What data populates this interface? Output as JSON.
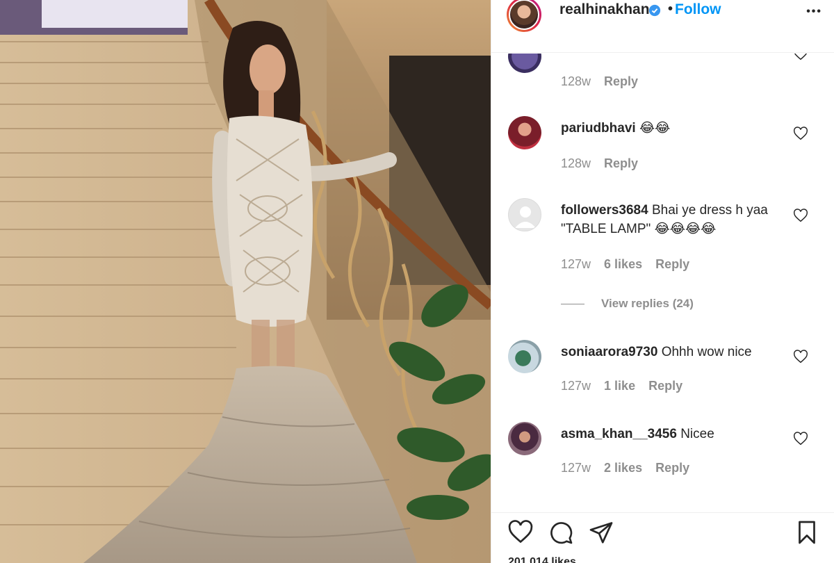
{
  "post": {
    "username": "realhinakhan",
    "follow_label": "Follow",
    "dot": "•",
    "more_label": "•••",
    "likes_partial": "201,014 likes"
  },
  "comments": [
    {
      "username": "",
      "text": "",
      "time": "128w",
      "likes": "",
      "reply_label": "Reply"
    },
    {
      "username": "pariudbhavi",
      "text": "😂😂",
      "time": "128w",
      "likes": "",
      "reply_label": "Reply"
    },
    {
      "username": "followers3684",
      "text": "Bhai ye dress h yaa \"TABLE LAMP\" 😂😂😂😂",
      "time": "127w",
      "likes": "6 likes",
      "reply_label": "Reply",
      "view_replies": "View replies (24)"
    },
    {
      "username": "soniaarora9730",
      "text": "Ohhh wow nice",
      "time": "127w",
      "likes": "1 like",
      "reply_label": "Reply"
    },
    {
      "username": "asma_khan__3456",
      "text": "Nicee",
      "time": "127w",
      "likes": "2 likes",
      "reply_label": "Reply"
    }
  ],
  "colors": {
    "follow": "#0095f6",
    "muted": "#8e8e8e",
    "text": "#262626"
  },
  "icons": [
    "verified-badge-icon",
    "more-options-icon",
    "heart-icon",
    "comment-icon",
    "share-icon",
    "bookmark-icon"
  ]
}
